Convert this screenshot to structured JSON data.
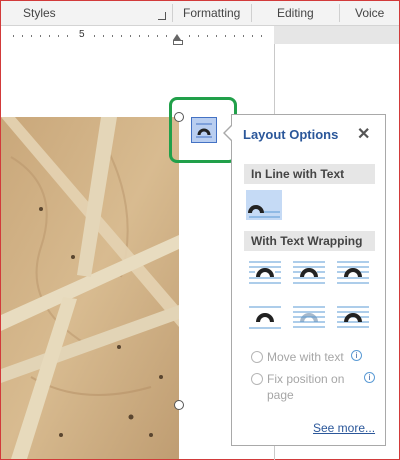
{
  "ribbon": {
    "styles_label": "Styles",
    "formatting_label": "Formatting",
    "editing_label": "Editing",
    "voice_label": "Voice"
  },
  "ruler": {
    "number": "5"
  },
  "layout_options": {
    "title": "Layout Options",
    "close_glyph": "✕",
    "inline_section": "In Line with Text",
    "wrapping_section": "With Text Wrapping",
    "move_with_text": "Move with text",
    "fix_position_line1": "Fix position on",
    "fix_position_line2": "page",
    "info_glyph": "i",
    "see_more": "See more..."
  },
  "colors": {
    "accent": "#2b579a",
    "highlight_border": "#21a04a",
    "selected_bg": "#c5daf5"
  }
}
